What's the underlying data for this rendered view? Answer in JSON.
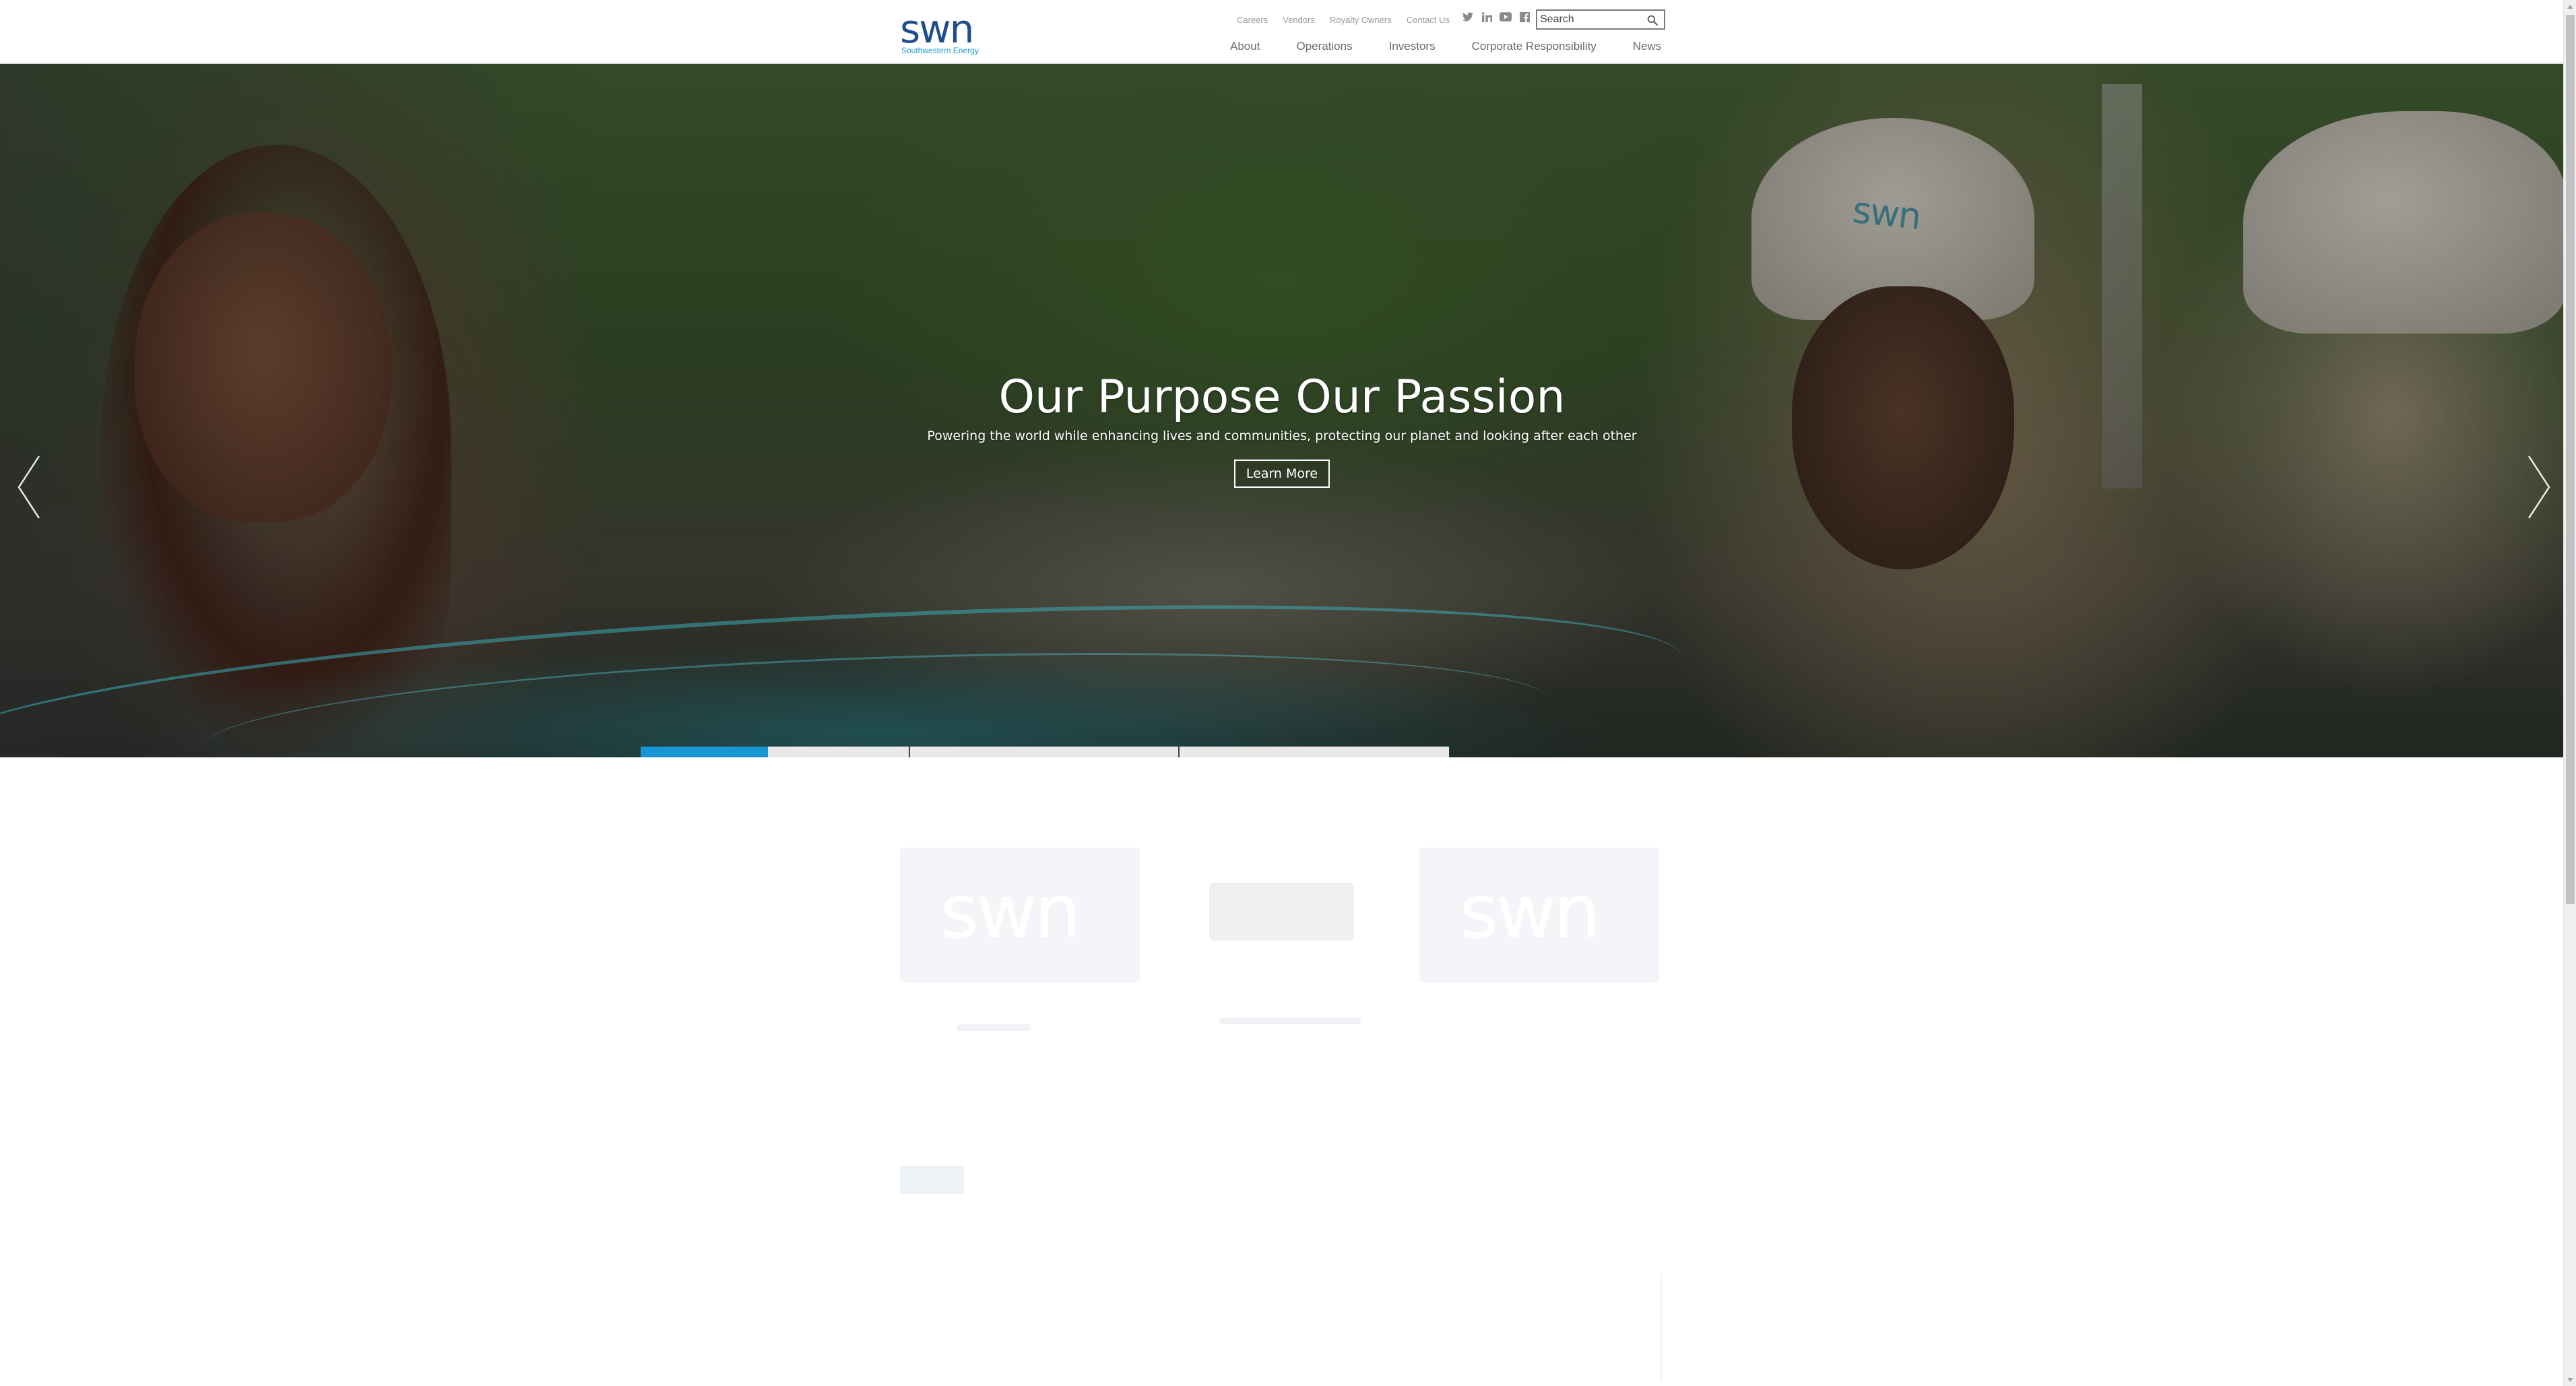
{
  "brand": {
    "logo_text": "swn",
    "tagline": "Southwestern Energy",
    "logo_color": "#1f4e8c",
    "tagline_color": "#1f9ad6"
  },
  "utility_nav": [
    {
      "label": "Careers"
    },
    {
      "label": "Vendors"
    },
    {
      "label": "Royalty Owners"
    },
    {
      "label": "Contact Us"
    }
  ],
  "social": [
    {
      "icon": "twitter-icon"
    },
    {
      "icon": "linkedin-icon"
    },
    {
      "icon": "youtube-icon"
    },
    {
      "icon": "facebook-icon"
    }
  ],
  "search": {
    "placeholder": "Search",
    "value": ""
  },
  "main_nav": [
    {
      "label": "About"
    },
    {
      "label": "Operations"
    },
    {
      "label": "Investors"
    },
    {
      "label": "Corporate Responsibility"
    },
    {
      "label": "News"
    }
  ],
  "hero": {
    "title": "Our Purpose Our Passion",
    "subtitle": "Powering the world while enhancing lives and communities, protecting our planet and looking after each other",
    "cta_label": "Learn More",
    "helmet_logo": "swn",
    "prev_icon": "chevron-left-icon",
    "next_icon": "chevron-right-icon"
  },
  "slider": {
    "slide_count": 4,
    "active_index": 0,
    "accent_color": "#1a95d3"
  },
  "cards": [
    {
      "logo": "swn"
    },
    {
      "logo": ""
    },
    {
      "logo": "swn"
    }
  ]
}
